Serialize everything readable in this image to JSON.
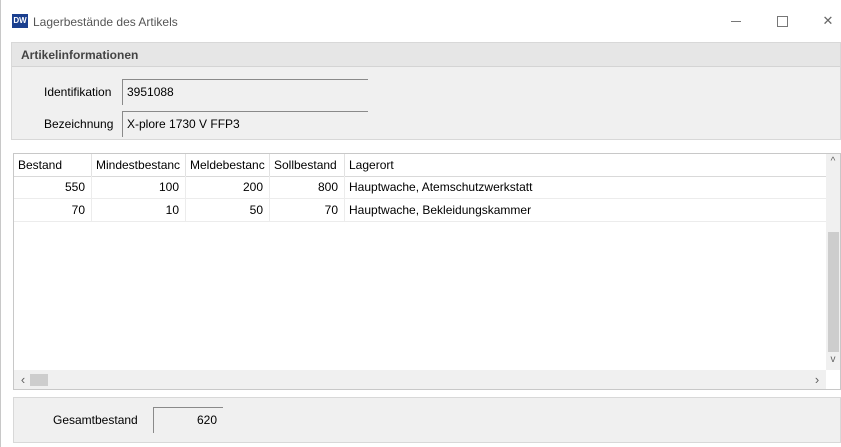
{
  "window": {
    "icon_text": "DW",
    "title": "Lagerbestände des Artikels"
  },
  "article_panel": {
    "header": "Artikelinformationen",
    "id_label": "Identifikation",
    "id_value": "3951088",
    "name_label": "Bezeichnung",
    "name_value": "X-plore 1730 V FFP3"
  },
  "table": {
    "columns": [
      "Bestand",
      "Mindestbestanc",
      "Meldebestanc",
      "Sollbestand",
      "Lagerort"
    ],
    "rows": [
      [
        "550",
        "100",
        "200",
        "800",
        "Hauptwache, Atemschutzwerkstatt"
      ],
      [
        "70",
        "10",
        "50",
        "70",
        "Hauptwache, Bekleidungskammer"
      ]
    ]
  },
  "totals": {
    "label": "Gesamtbestand",
    "value": "620"
  }
}
